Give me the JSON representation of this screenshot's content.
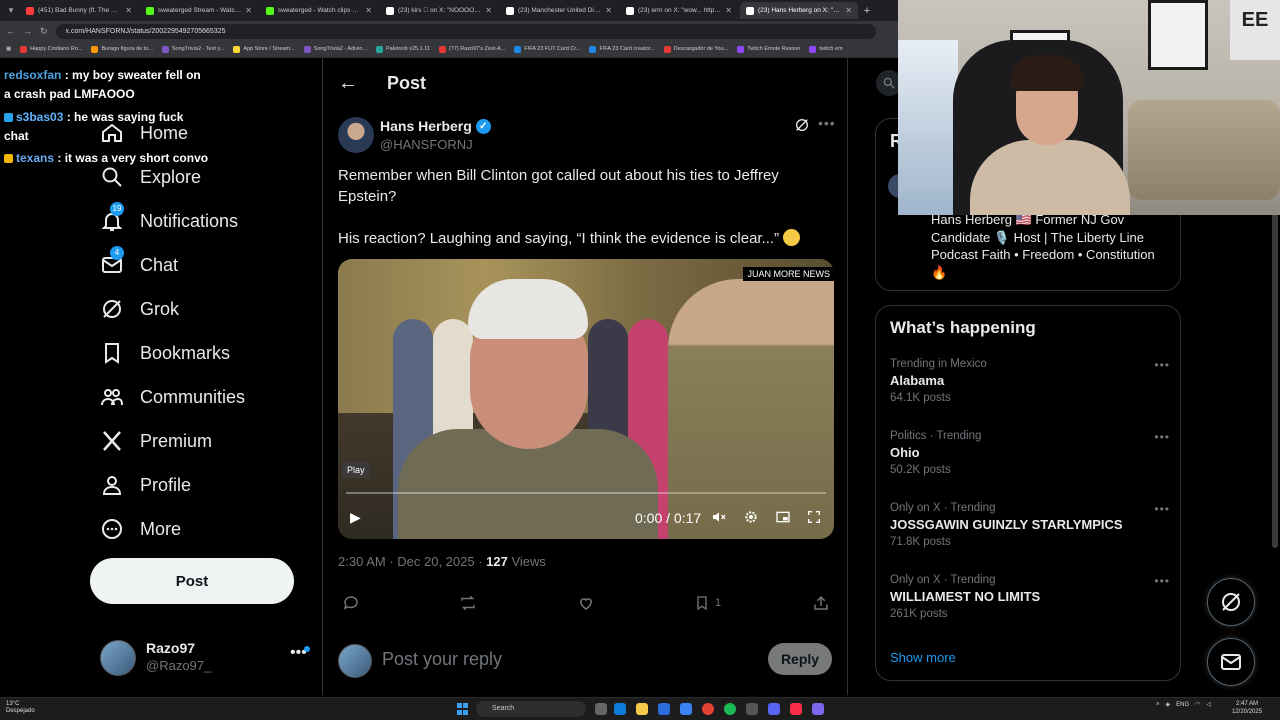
{
  "browser": {
    "tabs": [
      {
        "label": "(451) Bad Bunny (ft. The Marías)",
        "color": "#ff3b3b"
      },
      {
        "label": "sweaterged Stream - Watch Li...",
        "color": "#53fc18"
      },
      {
        "label": "sweaterged - Watch clips on Ki...",
        "color": "#53fc18"
      },
      {
        "label": "(23) kirs 🏼 on X: \"NOOOO W...",
        "color": "#ffffff"
      },
      {
        "label": "(23) Manchester United Die Ha...",
        "color": "#ffffff"
      },
      {
        "label": "(23) erm on X: \"wow... https://t...",
        "color": "#ffffff"
      },
      {
        "label": "(23) Hans Herberg on X: \"Reme...",
        "color": "#ffffff",
        "active": true
      }
    ],
    "url": "x.com/HANSFORNJ/status/2002295492705665325",
    "bookmarks": [
      {
        "label": "Happy Cristiano Ro...",
        "color": "#e53935"
      },
      {
        "label": "Burago figura de to...",
        "color": "#ff9800"
      },
      {
        "label": "SongTrivia2 - Test y...",
        "color": "#7e57c2"
      },
      {
        "label": "App Store / Stream...",
        "color": "#fdd835"
      },
      {
        "label": "SongTrivia2 - Adivin...",
        "color": "#7e57c2"
      },
      {
        "label": "Paletoob v25.1.11",
        "color": "#26a69a"
      },
      {
        "label": "(77) Razo97's Zest-A...",
        "color": "#e53935"
      },
      {
        "label": "FIFA 23 FUT Card Cr...",
        "color": "#1e88e5"
      },
      {
        "label": "FIFA 23 Card creator...",
        "color": "#1e88e5"
      },
      {
        "label": "Descargador de You...",
        "color": "#e53935"
      },
      {
        "label": "Twitch Emote Resizer",
        "color": "#9146ff"
      },
      {
        "label": "twitch em",
        "color": "#9146ff"
      }
    ]
  },
  "chat": [
    {
      "user": "redsoxfan",
      "msg": "my boy sweater fell on",
      "cont": "a crash pad LMFAOOO"
    },
    {
      "user": "s3bas03",
      "msg": "he was saying fuck",
      "cont": "chat"
    },
    {
      "user": "texans",
      "msg": "it was a very short convo"
    }
  ],
  "nav": {
    "items": [
      {
        "label": "Home",
        "icon": "home-icon"
      },
      {
        "label": "Explore",
        "icon": "search-icon"
      },
      {
        "label": "Notifications",
        "icon": "bell-icon",
        "badge": "19"
      },
      {
        "label": "Chat",
        "icon": "mail-icon",
        "badge": "4"
      },
      {
        "label": "Grok",
        "icon": "grok-icon"
      },
      {
        "label": "Bookmarks",
        "icon": "bookmark-icon"
      },
      {
        "label": "Communities",
        "icon": "communities-icon"
      },
      {
        "label": "Premium",
        "icon": "x-logo-icon"
      },
      {
        "label": "Profile",
        "icon": "person-icon"
      },
      {
        "label": "More",
        "icon": "more-circle-icon"
      }
    ],
    "post_label": "Post",
    "account": {
      "name": "Razo97",
      "handle": "@Razo97_"
    }
  },
  "post": {
    "header_title": "Post",
    "author_name": "Hans Herberg",
    "author_handle": "@HANSFORNJ",
    "text1": "Remember when Bill Clinton got called out about his ties to Jeffrey Epstein?",
    "text2": "His reaction? Laughing and saying, “I think the evidence is clear...”",
    "video": {
      "watermark": "JUAN MORE NEWS",
      "tooltip": "Play",
      "time": "0:00 / 0:17",
      "progress": 0
    },
    "meta_time": "2:30 AM · Dec 20, 2025 · ",
    "views_count": "127",
    "views_label": " Views",
    "bookmark_count": "1",
    "reply_placeholder": "Post your reply",
    "reply_label": "Reply"
  },
  "relevant": {
    "heading_letter": "R",
    "bio_text": "Hans Herberg 🇺🇸 Former NJ Gov Candidate 🎙️ Host | The Liberty Line Podcast Faith • Freedom • Constitution",
    "bio_emoji": "🔥"
  },
  "happening": {
    "title": "What’s happening",
    "trends": [
      {
        "context": "Trending in Mexico",
        "name": "Alabama",
        "count": "64.1K posts"
      },
      {
        "context": "Politics · Trending",
        "name": "Ohio",
        "count": "50.2K posts"
      },
      {
        "context": "Only on X · Trending",
        "name": "JOSSGAWIN GUINZLY STARLYMPICS",
        "count": "71.8K posts"
      },
      {
        "context": "Only on X · Trending",
        "name": "WILLIAMEST NO LIMITS",
        "count": "261K posts"
      }
    ],
    "show_more": "Show more"
  },
  "webcam": {
    "jersey_text": "EE"
  },
  "taskbar": {
    "weather_temp": "13°C",
    "weather_desc": "Despejado",
    "search": "Search",
    "lang": "ENG",
    "time": "2:47 AM",
    "date": "12/20/2025"
  },
  "colors": {
    "accent": "#1d9bf0",
    "background": "#000000",
    "text": "#e7e9ea",
    "muted": "#71767b"
  }
}
